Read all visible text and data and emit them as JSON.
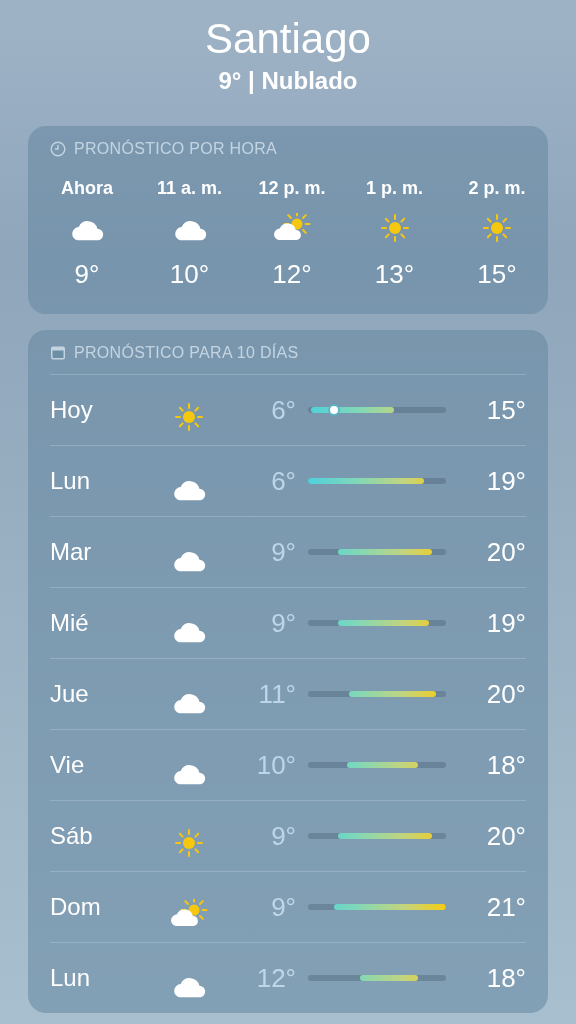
{
  "location": {
    "city": "Santiago",
    "summary": "9° | Nublado"
  },
  "hourly": {
    "title": "PRONÓSTICO POR HORA",
    "hours": [
      {
        "time": "Ahora",
        "kind": "cloud",
        "temp": "9°"
      },
      {
        "time": "11 a. m.",
        "kind": "cloud",
        "temp": "10°"
      },
      {
        "time": "12 p. m.",
        "kind": "partly",
        "temp": "12°"
      },
      {
        "time": "1 p. m.",
        "kind": "sun",
        "temp": "13°"
      },
      {
        "time": "2 p. m.",
        "kind": "sun",
        "temp": "15°"
      }
    ]
  },
  "daily": {
    "title": "PRONÓSTICO PARA 10 DÍAS",
    "days": [
      {
        "day": "Hoy",
        "kind": "sun",
        "low": "6°",
        "high": "15°",
        "current": {
          "level": 0.19
        }
      },
      {
        "day": "Lun",
        "kind": "cloud",
        "low": "6°",
        "high": "19°"
      },
      {
        "day": "Mar",
        "kind": "cloud",
        "low": "9°",
        "high": "20°"
      },
      {
        "day": "Mié",
        "kind": "cloud",
        "low": "9°",
        "high": "19°"
      },
      {
        "day": "Jue",
        "kind": "cloud",
        "low": "11°",
        "high": "20°"
      },
      {
        "day": "Vie",
        "kind": "cloud",
        "low": "10°",
        "high": "18°"
      },
      {
        "day": "Sáb",
        "kind": "sun",
        "low": "9°",
        "high": "20°"
      },
      {
        "day": "Dom",
        "kind": "partly",
        "low": "9°",
        "high": "21°"
      },
      {
        "day": "Lun",
        "kind": "cloud",
        "low": "12°",
        "high": "18°"
      }
    ]
  }
}
